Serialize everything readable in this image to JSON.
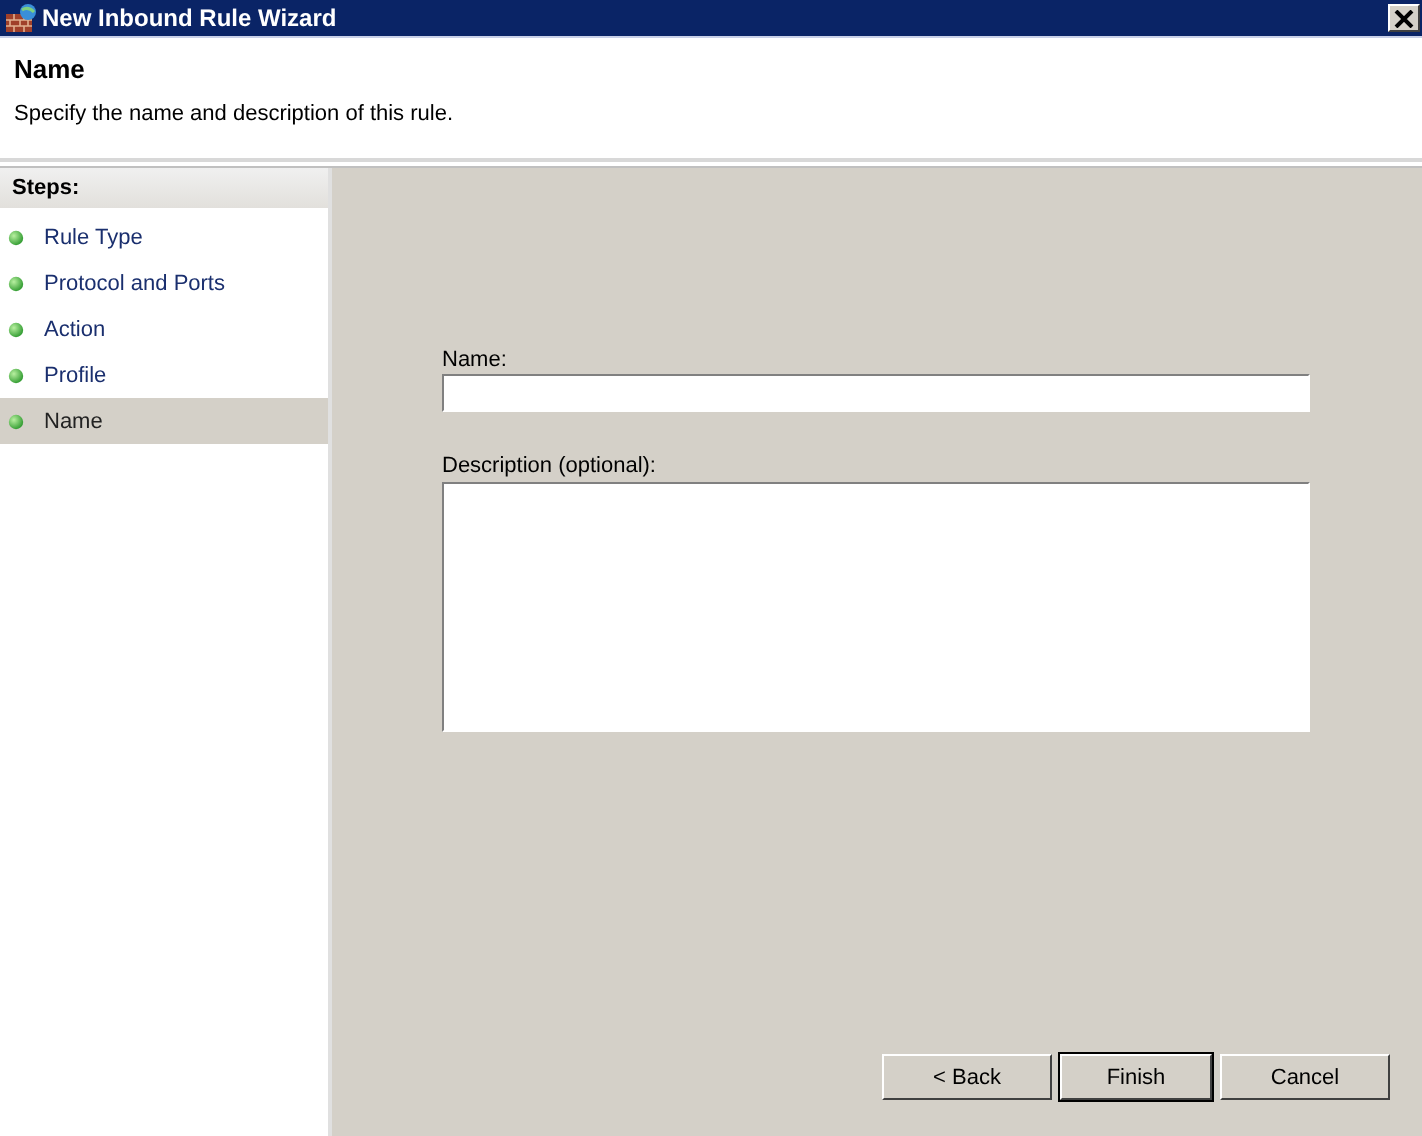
{
  "window": {
    "title": "New Inbound Rule Wizard"
  },
  "header": {
    "title": "Name",
    "subtitle": "Specify the name and description of this rule."
  },
  "steps": {
    "heading": "Steps:",
    "items": [
      {
        "label": "Rule Type",
        "selected": false
      },
      {
        "label": "Protocol and Ports",
        "selected": false
      },
      {
        "label": "Action",
        "selected": false
      },
      {
        "label": "Profile",
        "selected": false
      },
      {
        "label": "Name",
        "selected": true
      }
    ]
  },
  "form": {
    "name_label": "Name:",
    "description_label": "Description (optional):"
  },
  "buttons": [
    {
      "label": "< Back",
      "default": false
    },
    {
      "label": "Finish",
      "default": true
    },
    {
      "label": "Cancel",
      "default": false
    }
  ]
}
